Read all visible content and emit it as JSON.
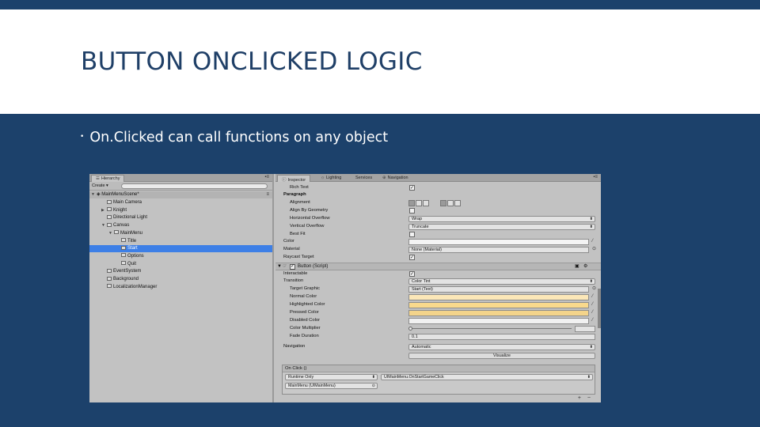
{
  "slide": {
    "title": "BUTTON ONCLICKED LOGIC",
    "bullet": "On.Clicked can call functions on any object"
  },
  "hierarchy": {
    "tab_label": "Hierarchy",
    "create_label": "Create ▾",
    "scene": "MainMenuScene*",
    "items": [
      {
        "label": "Main Camera",
        "indent": 1,
        "expander": ""
      },
      {
        "label": "Knight",
        "indent": 1,
        "expander": "▶"
      },
      {
        "label": "Directional Light",
        "indent": 1,
        "expander": ""
      },
      {
        "label": "Canvas",
        "indent": 1,
        "expander": "▼"
      },
      {
        "label": "MainMenu",
        "indent": 2,
        "expander": "▼"
      },
      {
        "label": "Title",
        "indent": 3,
        "expander": ""
      },
      {
        "label": "Start",
        "indent": 3,
        "expander": "",
        "selected": true
      },
      {
        "label": "Options",
        "indent": 3,
        "expander": ""
      },
      {
        "label": "Quit",
        "indent": 3,
        "expander": ""
      },
      {
        "label": "EventSystem",
        "indent": 1,
        "expander": ""
      },
      {
        "label": "Background",
        "indent": 1,
        "expander": ""
      },
      {
        "label": "LocalizationManager",
        "indent": 1,
        "expander": ""
      }
    ]
  },
  "inspector": {
    "tabs": [
      "Inspector",
      "Lighting",
      "Services",
      "Navigation"
    ],
    "text_component": {
      "rich_text": "Rich Text",
      "paragraph": "Paragraph",
      "alignment": "Alignment",
      "align_by_geometry": "Align By Geometry",
      "horizontal_overflow": "Horizontal Overflow",
      "horizontal_overflow_value": "Wrap",
      "vertical_overflow": "Vertical Overflow",
      "vertical_overflow_value": "Truncate",
      "best_fit": "Best Fit",
      "color": "Color",
      "material": "Material",
      "material_value": "None (Material)",
      "raycast_target": "Raycast Target"
    },
    "button_component": {
      "header": "Button (Script)",
      "interactable": "Interactable",
      "transition": "Transition",
      "transition_value": "Color Tint",
      "target_graphic": "Target Graphic",
      "target_graphic_value": "Start (Text)",
      "normal_color": "Normal Color",
      "highlighted_color": "Highlighted Color",
      "pressed_color": "Pressed Color",
      "disabled_color": "Disabled Color",
      "color_multiplier": "Color Multiplier",
      "fade_duration": "Fade Duration",
      "fade_duration_value": "0.1",
      "navigation": "Navigation",
      "navigation_value": "Automatic",
      "visualize": "Visualize"
    },
    "on_click": {
      "header": "On Click ()",
      "runtime": "Runtime Only",
      "function": "UIMainMenu.OnStartGameClick",
      "target": "MainMenu (UIMainMenu)",
      "add_remove": "+ −"
    },
    "colors": {
      "white": "#f4f4f4",
      "normal": "#fbe7b8",
      "highlighted": "#f9d98c",
      "pressed": "#f4d48a",
      "disabled": "#f1f1f1",
      "selection": "#3d7fe6"
    }
  }
}
